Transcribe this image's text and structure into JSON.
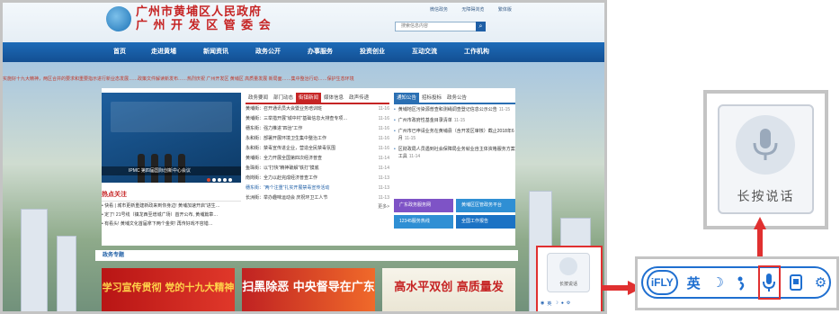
{
  "site": {
    "title_line1": "广州市黄埔区人民政府",
    "title_line2": "广 州 开 发 区 管 委 会",
    "top_links": [
      "微信政务",
      "无障碍浏览",
      "繁体版"
    ],
    "search_placeholder": "搜索信息内容"
  },
  "nav": [
    "首页",
    "走进黄埔",
    "新闻资讯",
    "政务公开",
    "办事服务",
    "投资创业",
    "互动交流",
    "工作机构"
  ],
  "marquee": "实施好十九大精神，两区合并的要求和重要指示进行新业态发展……政策文件解读新发布……热烈庆祝 广州开发区 黄埔区 高质量发展 新局面……集中整治行动……保护生态环境",
  "carousel": {
    "caption": "IPMC 第四届国际创新中心会议",
    "dots": [
      true,
      false,
      false,
      false,
      false
    ]
  },
  "focus": {
    "title": "热点关注",
    "items": [
      "• 快看 | 城市更新重建新政来到你身边! 黄埔加速开启“进生…",
      "• 定了! 21号线（镇龙西至增城广场）首开公布, 黄埔篇章…",
      "• 有看头! 黄埔文化首届拿下两个金奖! 再传好戏不容错…"
    ]
  },
  "news": {
    "tabs": [
      "政务要闻",
      "部门动态",
      "街镇新闻",
      "媒体信息",
      "政声传递"
    ],
    "active_tab": 2,
    "items": [
      {
        "title": "黄埔街：召开通讯员大会暨业务培训班",
        "date": "11-16",
        "highlight": false
      },
      {
        "title": "黄埔街：三举措开展“城中村”基础信息大排查专项…",
        "date": "11-16",
        "highlight": false
      },
      {
        "title": "穗东街：强力推进“四治”工作",
        "date": "11-16",
        "highlight": false
      },
      {
        "title": "永和街：部署开展环境卫生集中整治工作",
        "date": "11-16",
        "highlight": false
      },
      {
        "title": "永和街：禁毒宣传进企业，营造全民禁毒氛围",
        "date": "11-16",
        "highlight": false
      },
      {
        "title": "黄埔街：全力开展全国第四次经济普查",
        "date": "11-14",
        "highlight": false
      },
      {
        "title": "鱼珠街：以“打快”精神破解“铁打”摸底",
        "date": "11-14",
        "highlight": false
      },
      {
        "title": "南岗街：全力以赴完成经济普查工作",
        "date": "11-13",
        "highlight": false
      },
      {
        "title": "穗东街：“两个注重”扎实开展禁毒宣传活动",
        "date": "11-13",
        "highlight": true
      },
      {
        "title": "长洲街：举办趣味运动会 庆祝环卫工人节",
        "date": "11-13",
        "highlight": false
      }
    ],
    "more": "更多>"
  },
  "notices": {
    "tabs": [
      "通知公告",
      "招标投标",
      "政务公告"
    ],
    "active_tab": 0,
    "items": [
      {
        "text": "黄埔地区污染源普查和测绳调查登记信息公示公告",
        "date": "11-15"
      },
      {
        "text": "广州市政府性基金目录清单",
        "date": "11-15"
      },
      {
        "text": "广州市已申请业务在黄埔县（含开发区审核）截止2018年6月",
        "date": "11-15"
      },
      {
        "text": "区财政局人员遇到社会保障局业务就业自主体资格服务方案工具",
        "date": "11-14"
      }
    ],
    "services": [
      "广东政务服务网",
      "黄埔区区管政务平台",
      "12345服务热线",
      "全国工作报告"
    ]
  },
  "gov_section": {
    "title": "政务专题"
  },
  "banners": [
    {
      "text": "学习宣传贯彻 党的十九大精神",
      "sub": ""
    },
    {
      "text": "扫黑除恶 中央督导在广东",
      "sub": ""
    },
    {
      "text": "高水平双创 高质量发",
      "sub": ""
    }
  ],
  "voice_small": {
    "label": "长按说话"
  },
  "voice_zoom": {
    "label": "长按说话"
  },
  "toolbar": {
    "logo": "iFLY",
    "buttons": [
      {
        "name": "english-button",
        "label": "英"
      },
      {
        "name": "moon-icon",
        "label": "☽"
      },
      {
        "name": "speech-icon",
        "label": "♪"
      },
      {
        "name": "mic-icon",
        "label": ""
      },
      {
        "name": "card-icon",
        "label": ""
      },
      {
        "name": "gear-icon",
        "label": "⚙"
      }
    ]
  },
  "colors": {
    "accent_red": "#e03030",
    "brand_blue": "#1f6fd0",
    "nav_blue": "#1d6bb8"
  }
}
